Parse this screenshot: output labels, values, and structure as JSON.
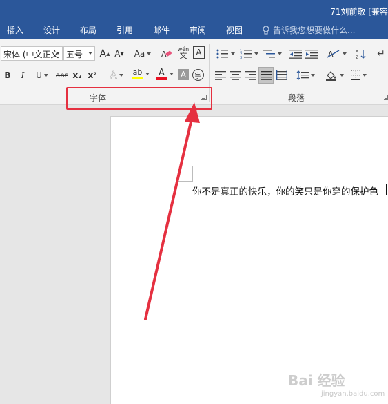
{
  "window": {
    "title": "71刘前敬 [兼容"
  },
  "tabs": {
    "items": [
      "插入",
      "设计",
      "布局",
      "引用",
      "邮件",
      "审阅",
      "视图"
    ],
    "tell_me": "告诉我您想要做什么..."
  },
  "ribbon": {
    "font_group": {
      "font_name": "宋体 (中文正文",
      "font_size": "五号",
      "grow_label": "A",
      "shrink_label": "A",
      "case_label": "Aa",
      "phonetic_top": "wén",
      "phonetic_bottom": "文",
      "border_label": "A",
      "bold": "B",
      "italic": "I",
      "underline": "U",
      "strike": "abc",
      "subscript": "x₂",
      "superscript": "x²",
      "effects_label": "A",
      "highlight_label": "ab",
      "color_label": "A",
      "shading_label": "A",
      "enclose_label": "字",
      "label": "字体",
      "highlight_color": "#ffff00",
      "font_color": "#e81123"
    },
    "paragraph_group": {
      "label": "段落"
    }
  },
  "document": {
    "text": "你不是真正的快乐，你的笑只是你穿的保护色"
  },
  "watermark": {
    "text": "Bai 经验",
    "url": "jingyan.baidu.com"
  },
  "annotation": {
    "color": "#e53040"
  }
}
